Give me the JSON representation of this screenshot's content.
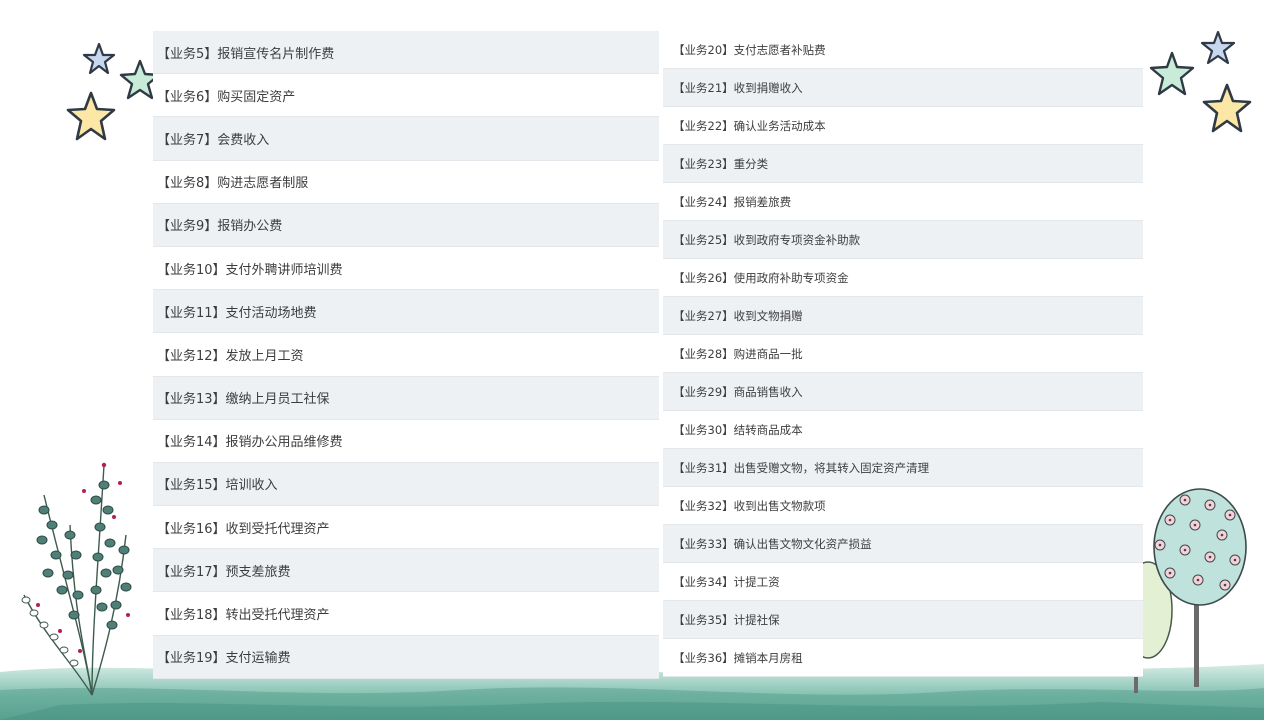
{
  "left_list": [
    "【业务5】报销宣传名片制作费",
    "【业务6】购买固定资产",
    "【业务7】会费收入",
    "【业务8】购进志愿者制服",
    "【业务9】报销办公费",
    "【业务10】支付外聘讲师培训费",
    "【业务11】支付活动场地费",
    "【业务12】发放上月工资",
    "【业务13】缴纳上月员工社保",
    "【业务14】报销办公用品维修费",
    "【业务15】培训收入",
    "【业务16】收到受托代理资产",
    "【业务17】预支差旅费",
    "【业务18】转出受托代理资产",
    "【业务19】支付运输费"
  ],
  "right_list": [
    "【业务20】支付志愿者补贴费",
    "【业务21】收到捐赠收入",
    "【业务22】确认业务活动成本",
    "【业务23】重分类",
    "【业务24】报销差旅费",
    "【业务25】收到政府专项资金补助款",
    "【业务26】使用政府补助专项资金",
    "【业务27】收到文物捐赠",
    "【业务28】购进商品一批",
    "【业务29】商品销售收入",
    "【业务30】结转商品成本",
    "【业务31】出售受赠文物，将其转入固定资产清理",
    "【业务32】收到出售文物款项",
    "【业务33】确认出售文物文化资产损益",
    "【业务34】计提工资",
    "【业务35】计提社保",
    "【业务36】摊销本月房租"
  ],
  "colors": {
    "row_stripe": "#eef1f4",
    "row_text": "#3d3d3d",
    "watercolor": "#7fbfae"
  },
  "icons": [
    "star-icon",
    "plant-illustration",
    "tree-illustration",
    "watercolor-background"
  ]
}
